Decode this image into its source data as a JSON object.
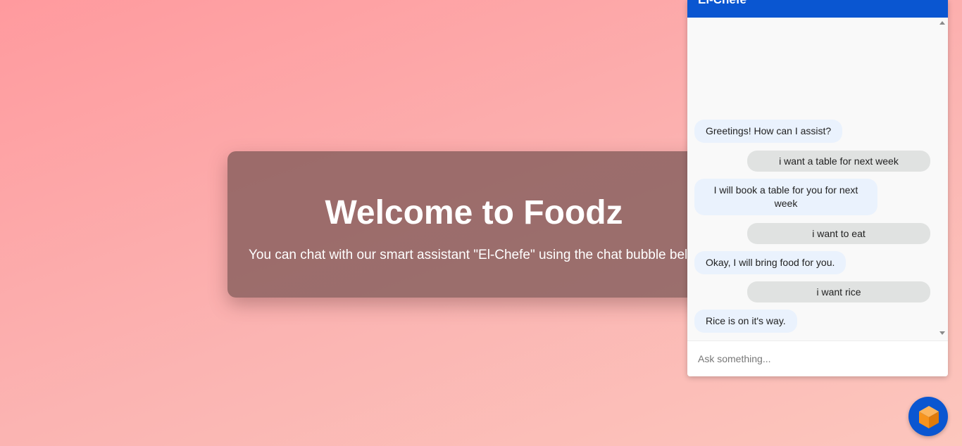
{
  "welcome": {
    "title": "Welcome to Foodz",
    "subtitle": "You can chat with our smart assistant \"El-Chefe\" using the chat bubble below."
  },
  "chat": {
    "title": "El-Chefe",
    "messages": [
      {
        "sender": "bot",
        "text": "Greetings! How can I assist?"
      },
      {
        "sender": "user",
        "text": "i want a table for next week"
      },
      {
        "sender": "bot",
        "text": "I will book a table for you for next week"
      },
      {
        "sender": "user",
        "text": "i want to eat"
      },
      {
        "sender": "bot",
        "text": "Okay, I will bring food for you."
      },
      {
        "sender": "user",
        "text": "i want rice"
      },
      {
        "sender": "bot",
        "text": "Rice is on it's way."
      }
    ],
    "input_placeholder": "Ask something..."
  },
  "launcher": {
    "icon": "cube-icon"
  },
  "colors": {
    "header": "#0a56d1",
    "launcher": "#0a56d1",
    "cube": "#f7941d",
    "bot_bubble": "#eaf2fd",
    "user_bubble": "#e0e2e1"
  }
}
